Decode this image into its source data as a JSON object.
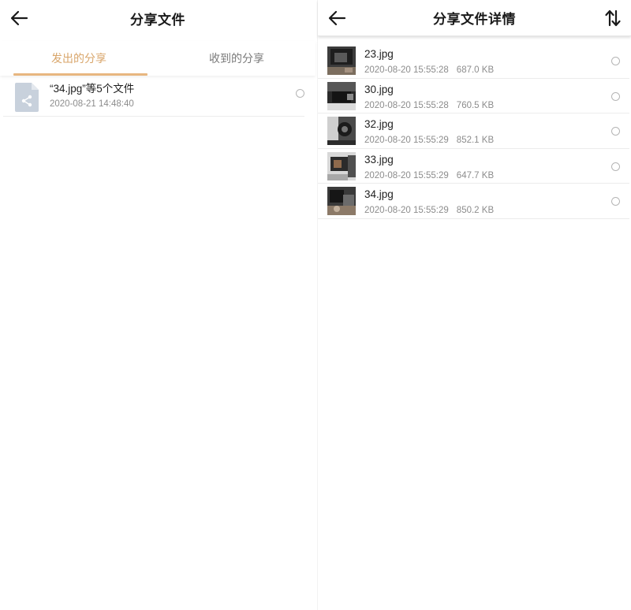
{
  "left": {
    "header": {
      "title": "分享文件"
    },
    "tabs": [
      {
        "label": "发出的分享",
        "active": true
      },
      {
        "label": "收到的分享",
        "active": false
      }
    ],
    "items": [
      {
        "name": "“34.jpg”等5个文件",
        "date": "2020-08-21 14:48:40",
        "icon": "share-file-icon"
      }
    ]
  },
  "right": {
    "header": {
      "title": "分享文件详情",
      "sort_icon": "sort-icon"
    },
    "files": [
      {
        "name": "23.jpg",
        "date": "2020-08-20 15:55:28",
        "size": "687.0 KB"
      },
      {
        "name": "30.jpg",
        "date": "2020-08-20 15:55:28",
        "size": "760.5 KB"
      },
      {
        "name": "32.jpg",
        "date": "2020-08-20 15:55:29",
        "size": "852.1 KB"
      },
      {
        "name": "33.jpg",
        "date": "2020-08-20 15:55:29",
        "size": "647.7 KB"
      },
      {
        "name": "34.jpg",
        "date": "2020-08-20 15:55:29",
        "size": "850.2 KB"
      }
    ]
  },
  "colors": {
    "accent": "#d9a66b",
    "underline": "#e7b680",
    "file_icon": "#c8d1dc",
    "text_primary": "#1f1f1f",
    "text_secondary": "#8c8c8c"
  }
}
